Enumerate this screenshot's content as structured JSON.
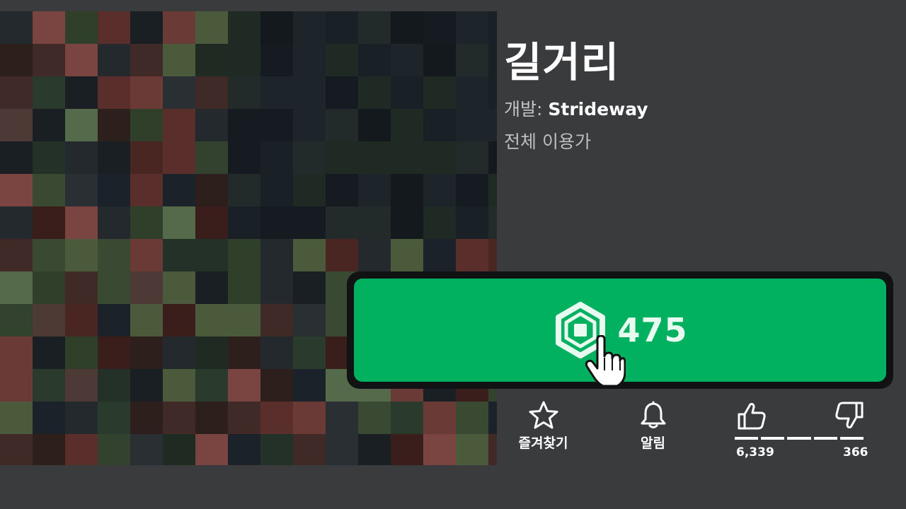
{
  "game": {
    "title": "길거리",
    "creator_label": "개발:",
    "creator_name": "Strideway",
    "age_rating": "전체 이용가"
  },
  "purchase": {
    "price": "475",
    "currency_icon": "robux-icon",
    "button_color": "#02b15f"
  },
  "actions": {
    "favorite_label": "즐겨찾기",
    "notify_label": "알림"
  },
  "votes": {
    "likes": "6,339",
    "dislikes": "366"
  },
  "colors": {
    "background": "#393b3d",
    "accent_green": "#02b15f"
  }
}
